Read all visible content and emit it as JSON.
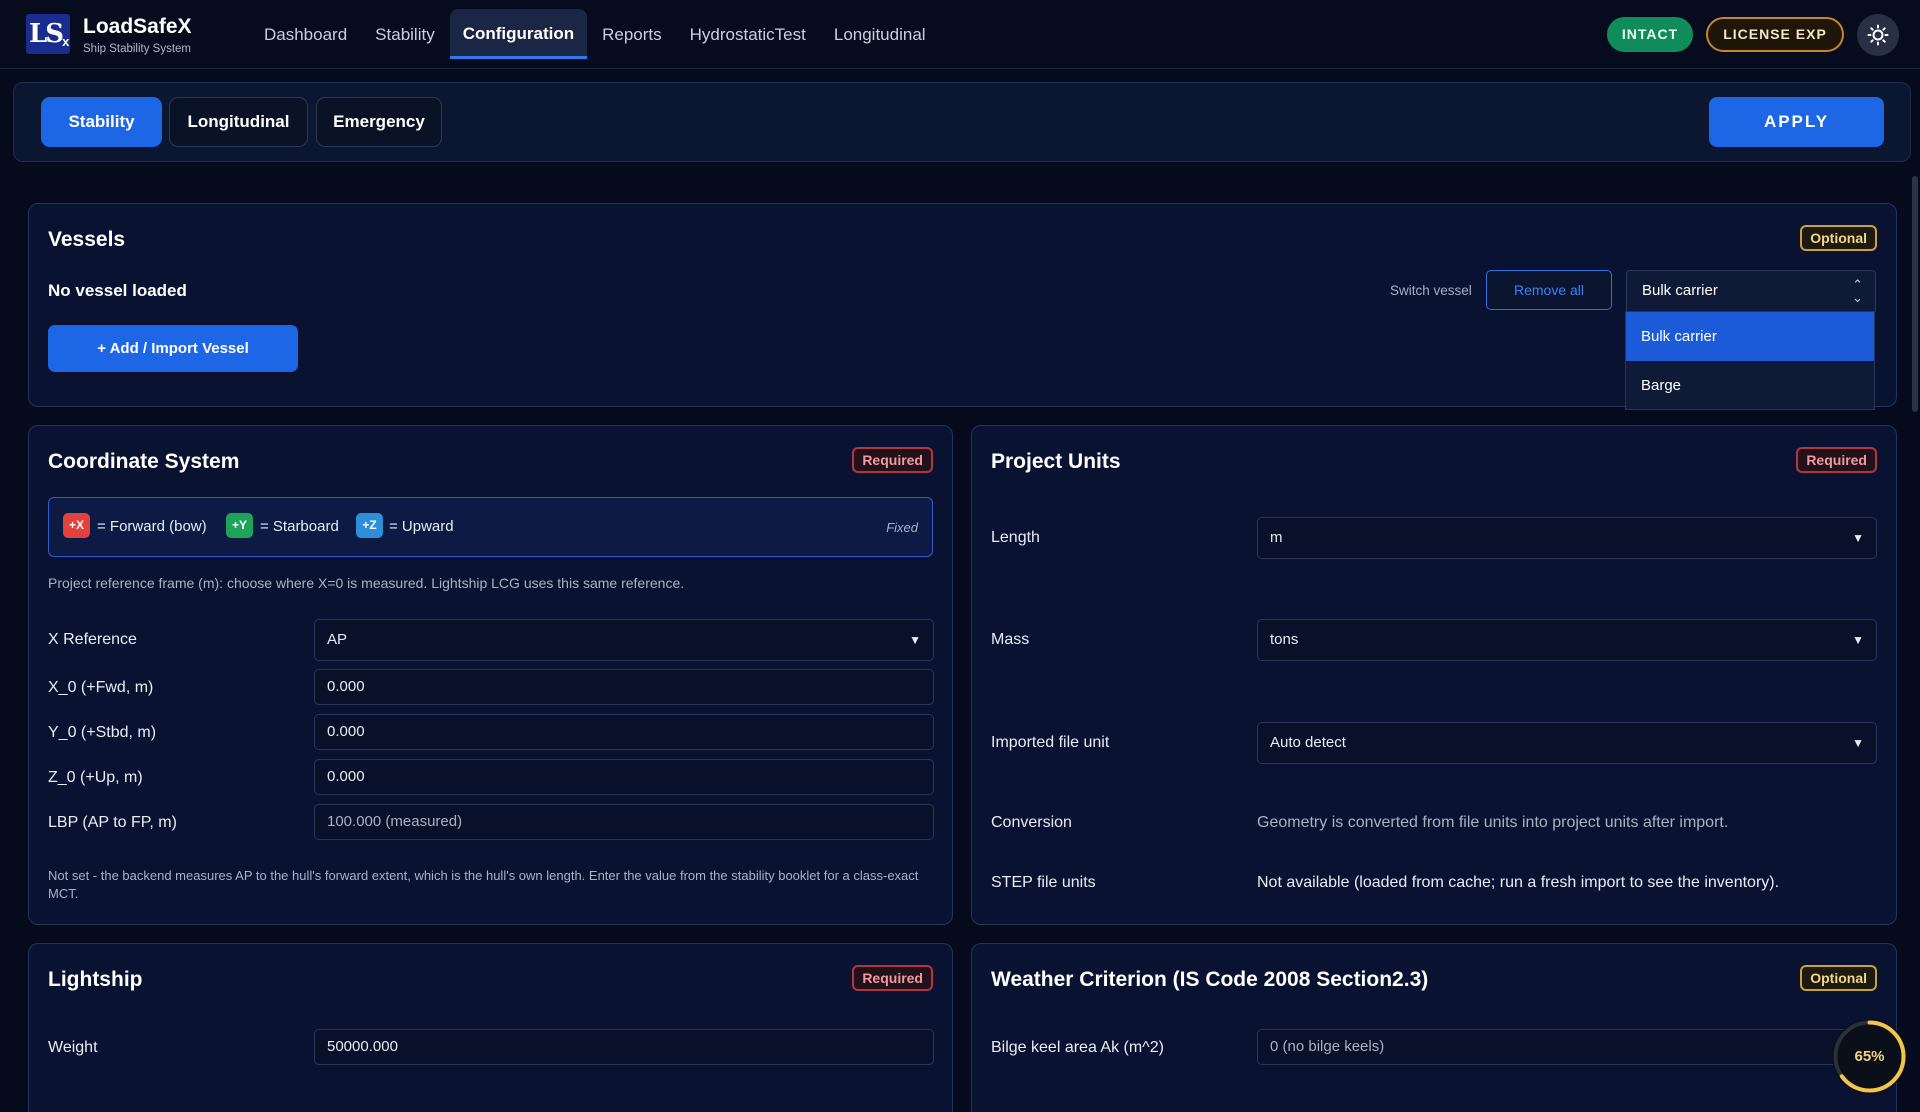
{
  "app": {
    "logo_text": "LS",
    "logo_sub": "x",
    "name": "LoadSafeX",
    "subtitle": "Ship Stability System"
  },
  "nav": {
    "items": [
      {
        "label": "Dashboard"
      },
      {
        "label": "Stability"
      },
      {
        "label": "Configuration"
      },
      {
        "label": "Reports"
      },
      {
        "label": "HydrostaticTest"
      },
      {
        "label": "Longitudinal"
      }
    ],
    "active_index": 2
  },
  "status": {
    "intact_label": "INTACT",
    "license_label": "LICENSE EXP",
    "theme_icon": "sun-icon"
  },
  "tabs": {
    "items": [
      {
        "label": "Stability"
      },
      {
        "label": "Longitudinal"
      },
      {
        "label": "Emergency"
      }
    ],
    "active_index": 0,
    "apply_label": "APPLY"
  },
  "vessels": {
    "title": "Vessels",
    "badge": "Optional",
    "empty_text": "No vessel loaded",
    "add_button": "+  Add / Import Vessel",
    "switch_label": "Switch vessel",
    "remove_all": "Remove all",
    "selected": "Bulk carrier",
    "options": [
      "Bulk carrier",
      "Barge"
    ]
  },
  "coordinate_system": {
    "title": "Coordinate System",
    "badge": "Required",
    "axes": [
      {
        "chip": "+X",
        "text": "= Forward (bow)",
        "color": "#e2413e"
      },
      {
        "chip": "+Y",
        "text": "= Starboard",
        "color": "#1fa35a"
      },
      {
        "chip": "+Z",
        "text": "= Upward",
        "color": "#2d8fd8"
      }
    ],
    "fixed_label": "Fixed",
    "help_text": "Project reference frame (m): choose where X=0 is measured. Lightship LCG uses this same reference.",
    "fields": {
      "x_reference": {
        "label": "X Reference",
        "value": "AP"
      },
      "x0": {
        "label": "X_0  (+Fwd, m)",
        "value": "0.000"
      },
      "y0": {
        "label": "Y_0  (+Stbd, m)",
        "value": "0.000"
      },
      "z0": {
        "label": "Z_0  (+Up, m)",
        "value": "0.000"
      },
      "lbp": {
        "label": "LBP  (AP to FP, m)",
        "placeholder": "100.000  (measured)"
      }
    },
    "footnote": "Not set - the backend measures AP to the hull's forward extent, which is the hull's own length. Enter the value from the stability booklet for a class-exact MCT."
  },
  "project_units": {
    "title": "Project Units",
    "badge": "Required",
    "length": {
      "label": "Length",
      "value": "m"
    },
    "mass": {
      "label": "Mass",
      "value": "tons"
    },
    "imported_unit": {
      "label": "Imported file unit",
      "value": "Auto detect"
    },
    "conversion": {
      "label": "Conversion",
      "value": "Geometry is converted from file units into project units after import."
    },
    "step_units": {
      "label": "STEP file units",
      "value": "Not available (loaded from cache; run a fresh import to see the inventory)."
    }
  },
  "lightship": {
    "title": "Lightship",
    "badge": "Required",
    "weight": {
      "label": "Weight",
      "value": "50000.000"
    }
  },
  "weather": {
    "title": "Weather Criterion (IS Code 2008 Section2.3)",
    "badge": "Optional",
    "bilge": {
      "label": "Bilge keel area Ak (m^2)",
      "placeholder": "0  (no bilge keels)"
    }
  },
  "progress": {
    "percent": 65,
    "label": "65%",
    "color": "#f3c64a"
  }
}
